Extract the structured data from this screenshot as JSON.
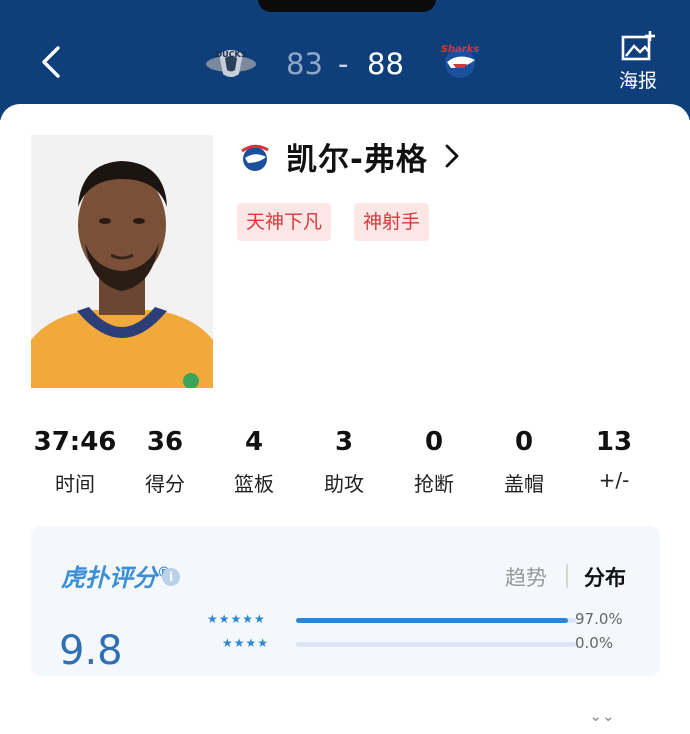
{
  "header": {
    "away_score": "83",
    "separator": "-",
    "home_score": "88",
    "poster_label": "海报",
    "away_team_logo_text": "DUCKS",
    "home_team_logo_text": "Sharks",
    "colors": {
      "background": "#0f3f7a",
      "score": "#ffffff",
      "away_score": "#8fa6c4"
    }
  },
  "player": {
    "name": "凯尔-弗格",
    "tags": [
      "天神下凡",
      "神射手"
    ],
    "tag_colors": {
      "background": "#fde6e6",
      "text": "#d73a3a"
    }
  },
  "stats": [
    {
      "value": "37:46",
      "label": "时间"
    },
    {
      "value": "36",
      "label": "得分"
    },
    {
      "value": "4",
      "label": "篮板"
    },
    {
      "value": "3",
      "label": "助攻"
    },
    {
      "value": "0",
      "label": "抢断"
    },
    {
      "value": "0",
      "label": "盖帽"
    },
    {
      "value": "13",
      "label": "+/-"
    }
  ],
  "rating": {
    "brand": "虎扑评分",
    "brand_mark": "®",
    "info_icon": "i",
    "tabs": [
      "趋势",
      "分布"
    ],
    "active_tab": "分布",
    "score": "9.8",
    "distribution": [
      {
        "stars": "★★★★★",
        "percent": "97.0%",
        "fraction": 0.97
      },
      {
        "stars": "★★★★",
        "percent": "0.0%",
        "fraction": 0.0
      }
    ]
  }
}
